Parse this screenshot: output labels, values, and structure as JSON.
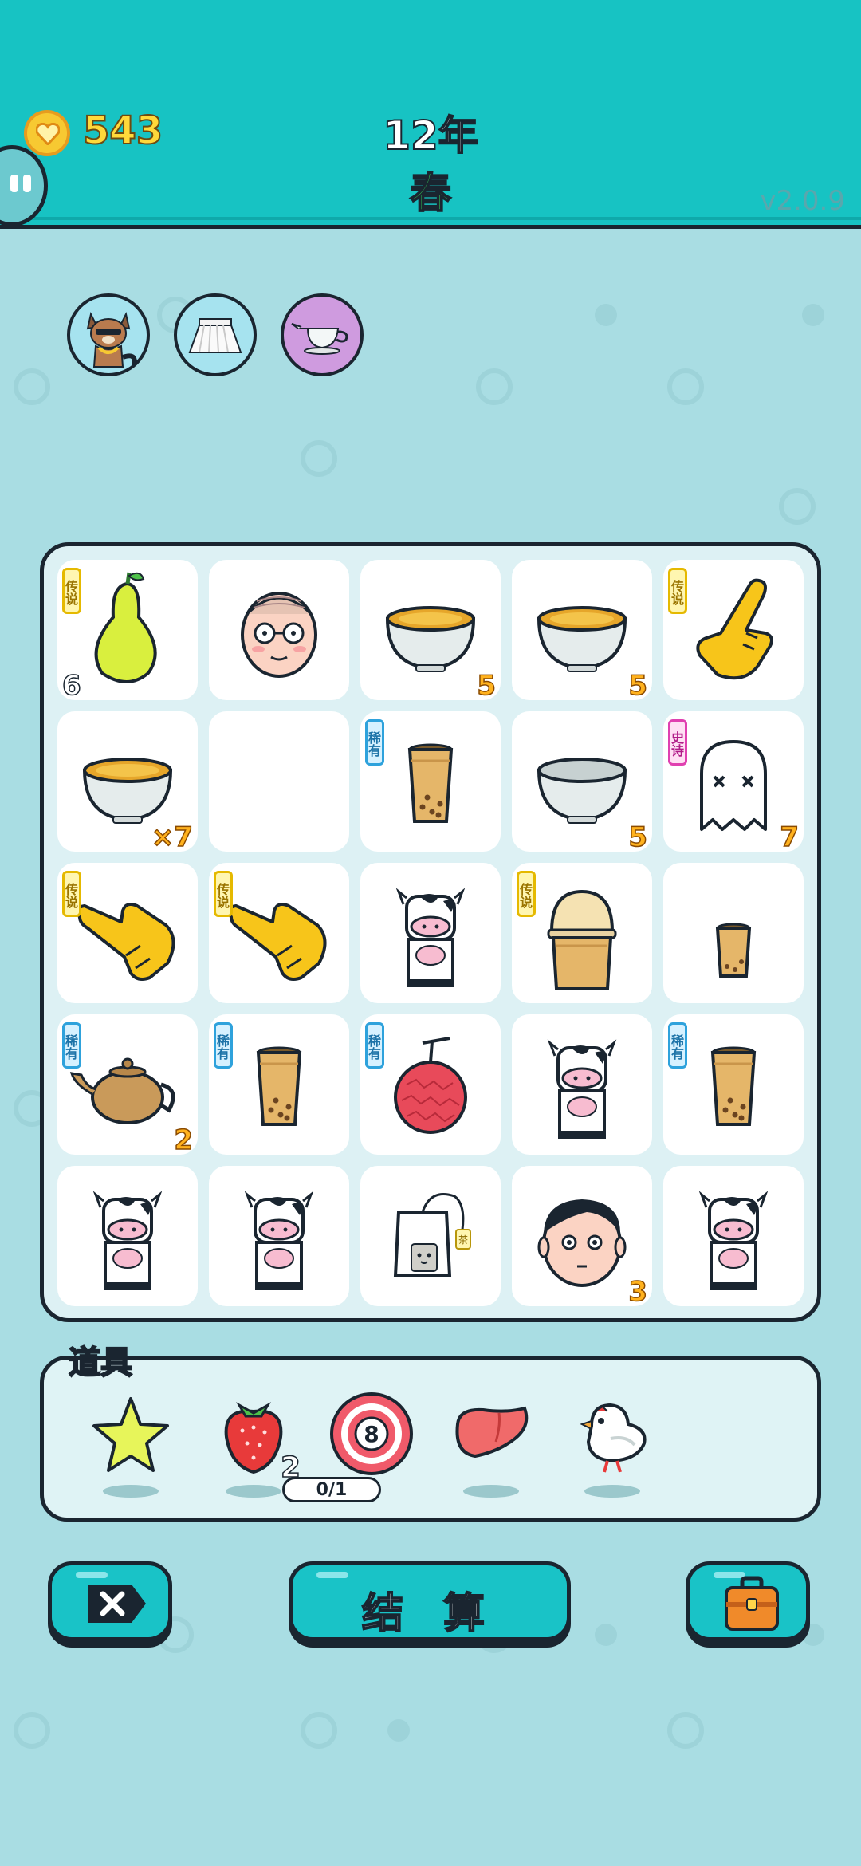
{
  "header": {
    "coins": "543",
    "year": "12年",
    "season": "春",
    "version": "v2.0.9"
  },
  "equipped": [
    {
      "name": "raccoon",
      "bg": "#a6e3ef"
    },
    {
      "name": "skirt",
      "bg": "#a6e3ef"
    },
    {
      "name": "cream-jug",
      "bg": "#cf9bdf"
    }
  ],
  "grid": [
    [
      {
        "item": "pear",
        "badge": "传说",
        "count": "6"
      },
      {
        "item": "old-man-face",
        "badge": "",
        "count": ""
      },
      {
        "item": "tea-bowl",
        "badge": "",
        "count": "5"
      },
      {
        "item": "tea-bowl",
        "badge": "",
        "count": "5"
      },
      {
        "item": "pointing-hand",
        "badge": "传说",
        "count": ""
      }
    ],
    [
      {
        "item": "tea-bowl",
        "badge": "",
        "count": "×7"
      },
      {
        "item": "empty",
        "badge": "",
        "count": ""
      },
      {
        "item": "milk-tea-cup",
        "badge": "稀有",
        "count": ""
      },
      {
        "item": "empty-bowl",
        "badge": "",
        "count": "5"
      },
      {
        "item": "ghost",
        "badge": "史诗",
        "count": "7"
      }
    ],
    [
      {
        "item": "pointing-hand",
        "badge": "传说",
        "count": ""
      },
      {
        "item": "pointing-hand",
        "badge": "传说",
        "count": ""
      },
      {
        "item": "cow",
        "badge": "",
        "count": ""
      },
      {
        "item": "big-milk-tea",
        "badge": "传说",
        "count": ""
      },
      {
        "item": "small-milk-tea",
        "badge": "",
        "count": ""
      }
    ],
    [
      {
        "item": "teapot",
        "badge": "稀有",
        "count": "2"
      },
      {
        "item": "milk-tea-cup",
        "badge": "稀有",
        "count": ""
      },
      {
        "item": "lychee",
        "badge": "稀有",
        "count": ""
      },
      {
        "item": "cow",
        "badge": "",
        "count": ""
      },
      {
        "item": "milk-tea-cup",
        "badge": "稀有",
        "count": ""
      }
    ],
    [
      {
        "item": "cow",
        "badge": "",
        "count": ""
      },
      {
        "item": "cow",
        "badge": "",
        "count": ""
      },
      {
        "item": "tea-bag",
        "badge": "",
        "count": ""
      },
      {
        "item": "boy-face",
        "badge": "",
        "count": "3"
      },
      {
        "item": "cow",
        "badge": "",
        "count": ""
      }
    ]
  ],
  "items": {
    "title": "道具",
    "list": [
      {
        "name": "star",
        "count": ""
      },
      {
        "name": "strawberry",
        "count": "2"
      },
      {
        "name": "target-8",
        "count": "0/1"
      },
      {
        "name": "liver",
        "count": ""
      },
      {
        "name": "white-bird",
        "count": ""
      }
    ]
  },
  "buttons": {
    "settle": "结 算"
  },
  "colors": {
    "header": "#17c3c3",
    "background": "#a9dde3",
    "button": "#19c3c7",
    "outline": "#1a2530"
  }
}
